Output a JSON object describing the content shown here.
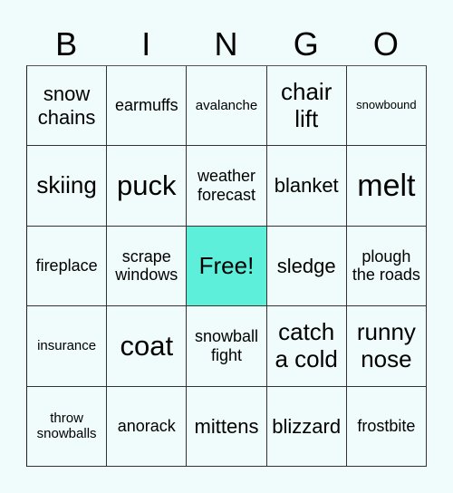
{
  "header": {
    "letters": [
      "B",
      "I",
      "N",
      "G",
      "O"
    ]
  },
  "board": {
    "free_color": "#5eefdb",
    "background_color": "#effcfb",
    "rows": [
      [
        {
          "text": "snow chains",
          "size": "s-lg"
        },
        {
          "text": "earmuffs",
          "size": "s-md"
        },
        {
          "text": "avalanche",
          "size": "s-sm"
        },
        {
          "text": "chair lift",
          "size": "s-xl"
        },
        {
          "text": "snowbound",
          "size": "s-xs"
        }
      ],
      [
        {
          "text": "skiing",
          "size": "s-xl"
        },
        {
          "text": "puck",
          "size": "s-xxl"
        },
        {
          "text": "weather forecast",
          "size": "s-md"
        },
        {
          "text": "blanket",
          "size": "s-lg"
        },
        {
          "text": "melt",
          "size": "s-xxxl"
        }
      ],
      [
        {
          "text": "fireplace",
          "size": "s-md"
        },
        {
          "text": "scrape windows",
          "size": "s-md"
        },
        {
          "text": "Free!",
          "size": "s-xl",
          "free": true
        },
        {
          "text": "sledge",
          "size": "s-lg"
        },
        {
          "text": "plough the roads",
          "size": "s-md"
        }
      ],
      [
        {
          "text": "insurance",
          "size": "s-sm"
        },
        {
          "text": "coat",
          "size": "s-xxl"
        },
        {
          "text": "snowball fight",
          "size": "s-md"
        },
        {
          "text": "catch a cold",
          "size": "s-xl"
        },
        {
          "text": "runny nose",
          "size": "s-xl"
        }
      ],
      [
        {
          "text": "throw snowballs",
          "size": "s-sm"
        },
        {
          "text": "anorack",
          "size": "s-md"
        },
        {
          "text": "mittens",
          "size": "s-lg"
        },
        {
          "text": "blizzard",
          "size": "s-lg"
        },
        {
          "text": "frostbite",
          "size": "s-md"
        }
      ]
    ]
  }
}
